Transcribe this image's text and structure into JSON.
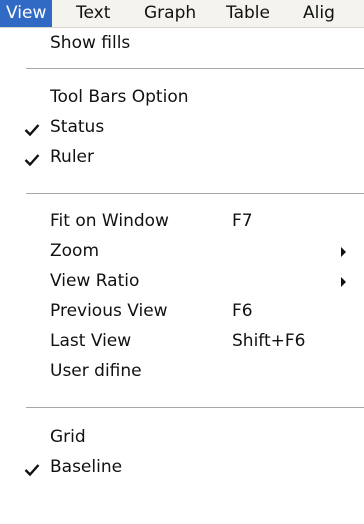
{
  "menubar": {
    "items": [
      {
        "label": "View"
      },
      {
        "label": "Text"
      },
      {
        "label": "Graph"
      },
      {
        "label": "Table"
      },
      {
        "label": "Alig"
      }
    ]
  },
  "menu": {
    "items": [
      {
        "label": "Show fills",
        "checked": false
      },
      {
        "label": "Tool Bars Option",
        "checked": false
      },
      {
        "label": "Status",
        "checked": true
      },
      {
        "label": "Ruler",
        "checked": true
      },
      {
        "label": "Fit on Window",
        "shortcut": "F7"
      },
      {
        "label": "Zoom",
        "submenu": true
      },
      {
        "label": "View Ratio",
        "submenu": true
      },
      {
        "label": "Previous View",
        "shortcut": "F6"
      },
      {
        "label": "Last View",
        "shortcut": "Shift+F6"
      },
      {
        "label": "User difine"
      },
      {
        "label": "Grid",
        "checked": false
      },
      {
        "label": "Baseline",
        "checked": true
      }
    ]
  },
  "colors": {
    "highlight": "#316ac5",
    "menubar_bg": "#f4f3ee"
  }
}
